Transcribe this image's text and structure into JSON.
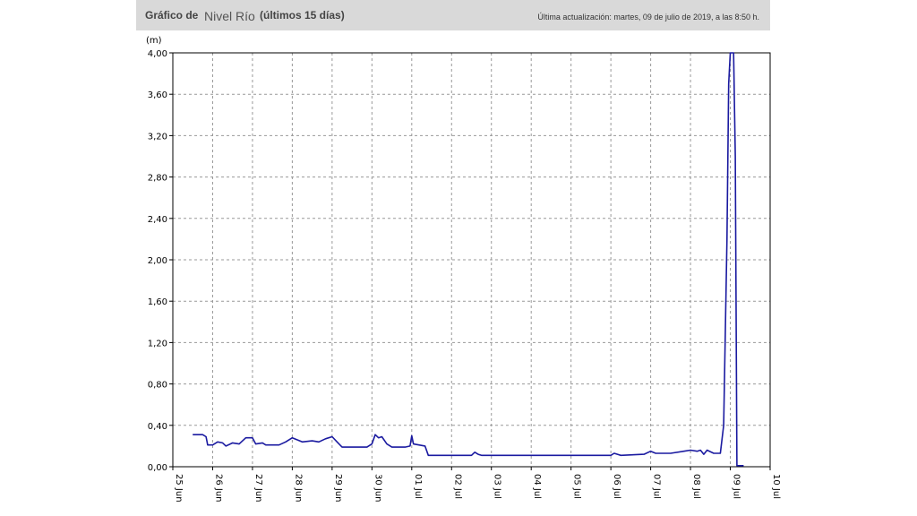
{
  "header": {
    "title_prefix": "Gráfico de",
    "variable": "Nivel Río",
    "range": "(últimos 15 días)",
    "last_update": "Última actualización: martes, 09 de julio de 2019, a las 8:50 h."
  },
  "colors": {
    "header_bg": "#d9d9d9",
    "series": "#1a1aa0",
    "grid": "#999999"
  },
  "chart_data": {
    "type": "line",
    "title": "",
    "xlabel": "",
    "ylabel": "(m)",
    "grid": true,
    "ylim": [
      0,
      4.0
    ],
    "xlim": [
      "2019-06-25",
      "2019-07-10"
    ],
    "y_ticks": [
      "0,00",
      "0,40",
      "0,80",
      "1,20",
      "1,60",
      "2,00",
      "2,40",
      "2,80",
      "3,20",
      "3,60",
      "4,00"
    ],
    "x_ticks": [
      "25 Jun",
      "26 Jun",
      "27 Jun",
      "28 Jun",
      "29 Jun",
      "30 Jun",
      "01 Jul",
      "02 Jul",
      "03 Jul",
      "04 Jul",
      "05 Jul",
      "06 Jul",
      "07 Jul",
      "08 Jul",
      "09 Jul",
      "10 Jul"
    ],
    "series": [
      {
        "name": "",
        "points": [
          [
            "2019-06-25 12:00",
            0.31
          ],
          [
            "2019-06-25 18:00",
            0.31
          ],
          [
            "2019-06-25 20:00",
            0.29
          ],
          [
            "2019-06-25 21:00",
            0.21
          ],
          [
            "2019-06-26 00:00",
            0.21
          ],
          [
            "2019-06-26 03:00",
            0.24
          ],
          [
            "2019-06-26 06:00",
            0.23
          ],
          [
            "2019-06-26 08:00",
            0.2
          ],
          [
            "2019-06-26 12:00",
            0.23
          ],
          [
            "2019-06-26 16:00",
            0.22
          ],
          [
            "2019-06-26 20:00",
            0.28
          ],
          [
            "2019-06-27 00:00",
            0.28
          ],
          [
            "2019-06-27 02:00",
            0.22
          ],
          [
            "2019-06-27 06:00",
            0.23
          ],
          [
            "2019-06-27 08:00",
            0.21
          ],
          [
            "2019-06-27 16:00",
            0.21
          ],
          [
            "2019-06-27 20:00",
            0.24
          ],
          [
            "2019-06-28 00:00",
            0.28
          ],
          [
            "2019-06-28 03:00",
            0.26
          ],
          [
            "2019-06-28 06:00",
            0.24
          ],
          [
            "2019-06-28 12:00",
            0.25
          ],
          [
            "2019-06-28 16:00",
            0.24
          ],
          [
            "2019-06-28 20:00",
            0.27
          ],
          [
            "2019-06-29 00:00",
            0.29
          ],
          [
            "2019-06-29 03:00",
            0.24
          ],
          [
            "2019-06-29 06:00",
            0.19
          ],
          [
            "2019-06-29 21:00",
            0.19
          ],
          [
            "2019-06-30 00:00",
            0.22
          ],
          [
            "2019-06-30 02:00",
            0.31
          ],
          [
            "2019-06-30 04:00",
            0.28
          ],
          [
            "2019-06-30 06:00",
            0.29
          ],
          [
            "2019-06-30 09:00",
            0.22
          ],
          [
            "2019-06-30 12:00",
            0.19
          ],
          [
            "2019-06-30 20:00",
            0.19
          ],
          [
            "2019-06-30 23:00",
            0.2
          ],
          [
            "2019-07-01 00:00",
            0.3
          ],
          [
            "2019-07-01 01:00",
            0.22
          ],
          [
            "2019-07-01 08:00",
            0.2
          ],
          [
            "2019-07-01 10:00",
            0.11
          ],
          [
            "2019-07-02 12:00",
            0.11
          ],
          [
            "2019-07-02 14:00",
            0.14
          ],
          [
            "2019-07-02 16:00",
            0.12
          ],
          [
            "2019-07-02 18:00",
            0.11
          ],
          [
            "2019-07-06 00:00",
            0.11
          ],
          [
            "2019-07-06 02:00",
            0.13
          ],
          [
            "2019-07-06 06:00",
            0.11
          ],
          [
            "2019-07-06 20:00",
            0.12
          ],
          [
            "2019-07-07 00:00",
            0.15
          ],
          [
            "2019-07-07 03:00",
            0.13
          ],
          [
            "2019-07-07 12:00",
            0.13
          ],
          [
            "2019-07-07 20:00",
            0.15
          ],
          [
            "2019-07-08 00:00",
            0.16
          ],
          [
            "2019-07-08 04:00",
            0.15
          ],
          [
            "2019-07-08 06:00",
            0.16
          ],
          [
            "2019-07-08 08:00",
            0.12
          ],
          [
            "2019-07-08 10:00",
            0.16
          ],
          [
            "2019-07-08 14:00",
            0.13
          ],
          [
            "2019-07-08 18:00",
            0.13
          ],
          [
            "2019-07-08 20:00",
            0.4
          ],
          [
            "2019-07-08 22:00",
            2.2
          ],
          [
            "2019-07-08 23:00",
            3.7
          ],
          [
            "2019-07-09 00:00",
            4.0
          ],
          [
            "2019-07-09 02:00",
            4.0
          ],
          [
            "2019-07-09 03:00",
            3.0
          ],
          [
            "2019-07-09 04:00",
            0.01
          ],
          [
            "2019-07-09 08:00",
            0.01
          ]
        ]
      }
    ]
  }
}
